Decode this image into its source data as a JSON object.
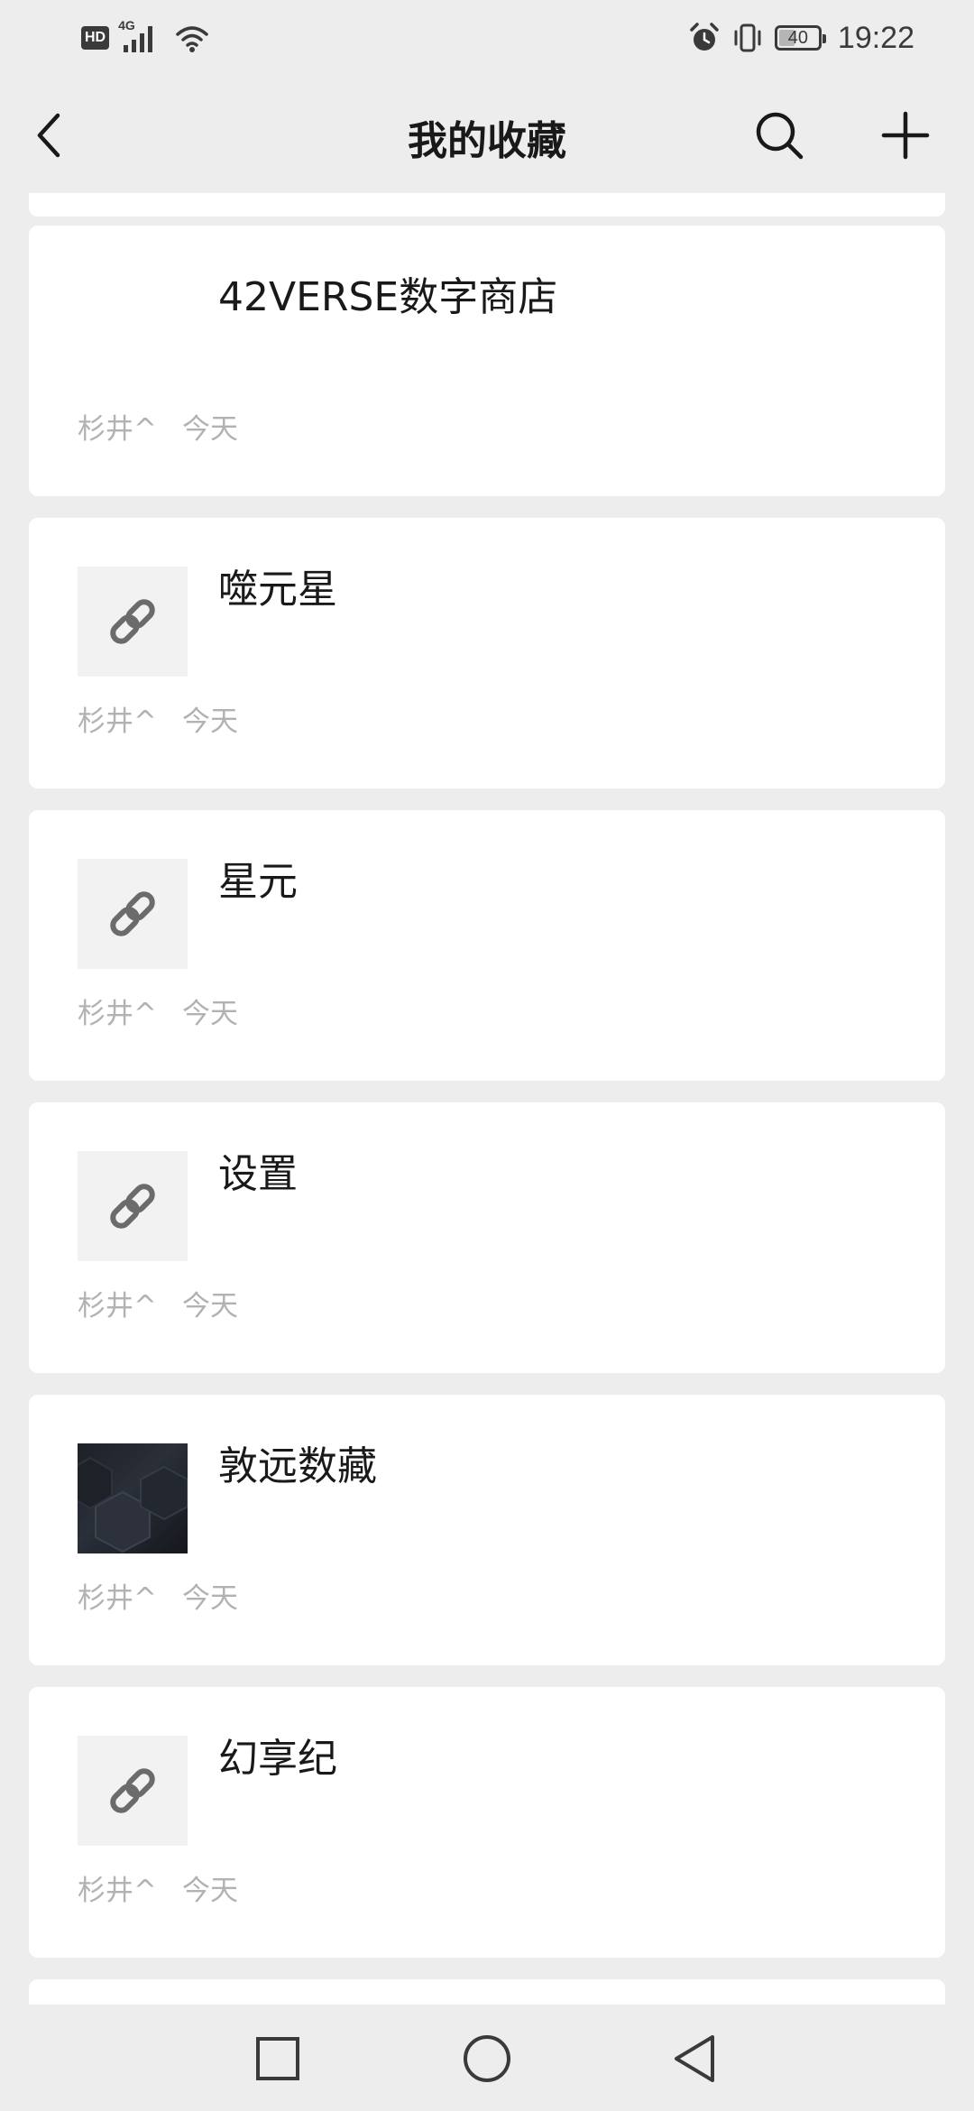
{
  "status_bar": {
    "hd": "HD",
    "network": "4G",
    "battery": "40",
    "battery_level": 0.4,
    "time": "19:22"
  },
  "nav": {
    "title": "我的收藏"
  },
  "items": [
    {
      "title": "42VERSE数字商店",
      "author": "杉井^",
      "date": "今天",
      "thumb": "none"
    },
    {
      "title": "噬元星",
      "author": "杉井^",
      "date": "今天",
      "thumb": "link-icon"
    },
    {
      "title": "星元",
      "author": "杉井^",
      "date": "今天",
      "thumb": "link-icon"
    },
    {
      "title": "设置",
      "author": "杉井^",
      "date": "今天",
      "thumb": "link-icon"
    },
    {
      "title": "敦远数藏",
      "author": "杉井^",
      "date": "今天",
      "thumb": "image"
    },
    {
      "title": "幻享纪",
      "author": "杉井^",
      "date": "今天",
      "thumb": "link-icon"
    }
  ],
  "colors": {
    "background": "#ededed",
    "card": "#ffffff",
    "title": "#191919",
    "meta": "#b2b2b2",
    "thumb_bg": "#f2f2f2",
    "icon": "#6b6b6b"
  }
}
